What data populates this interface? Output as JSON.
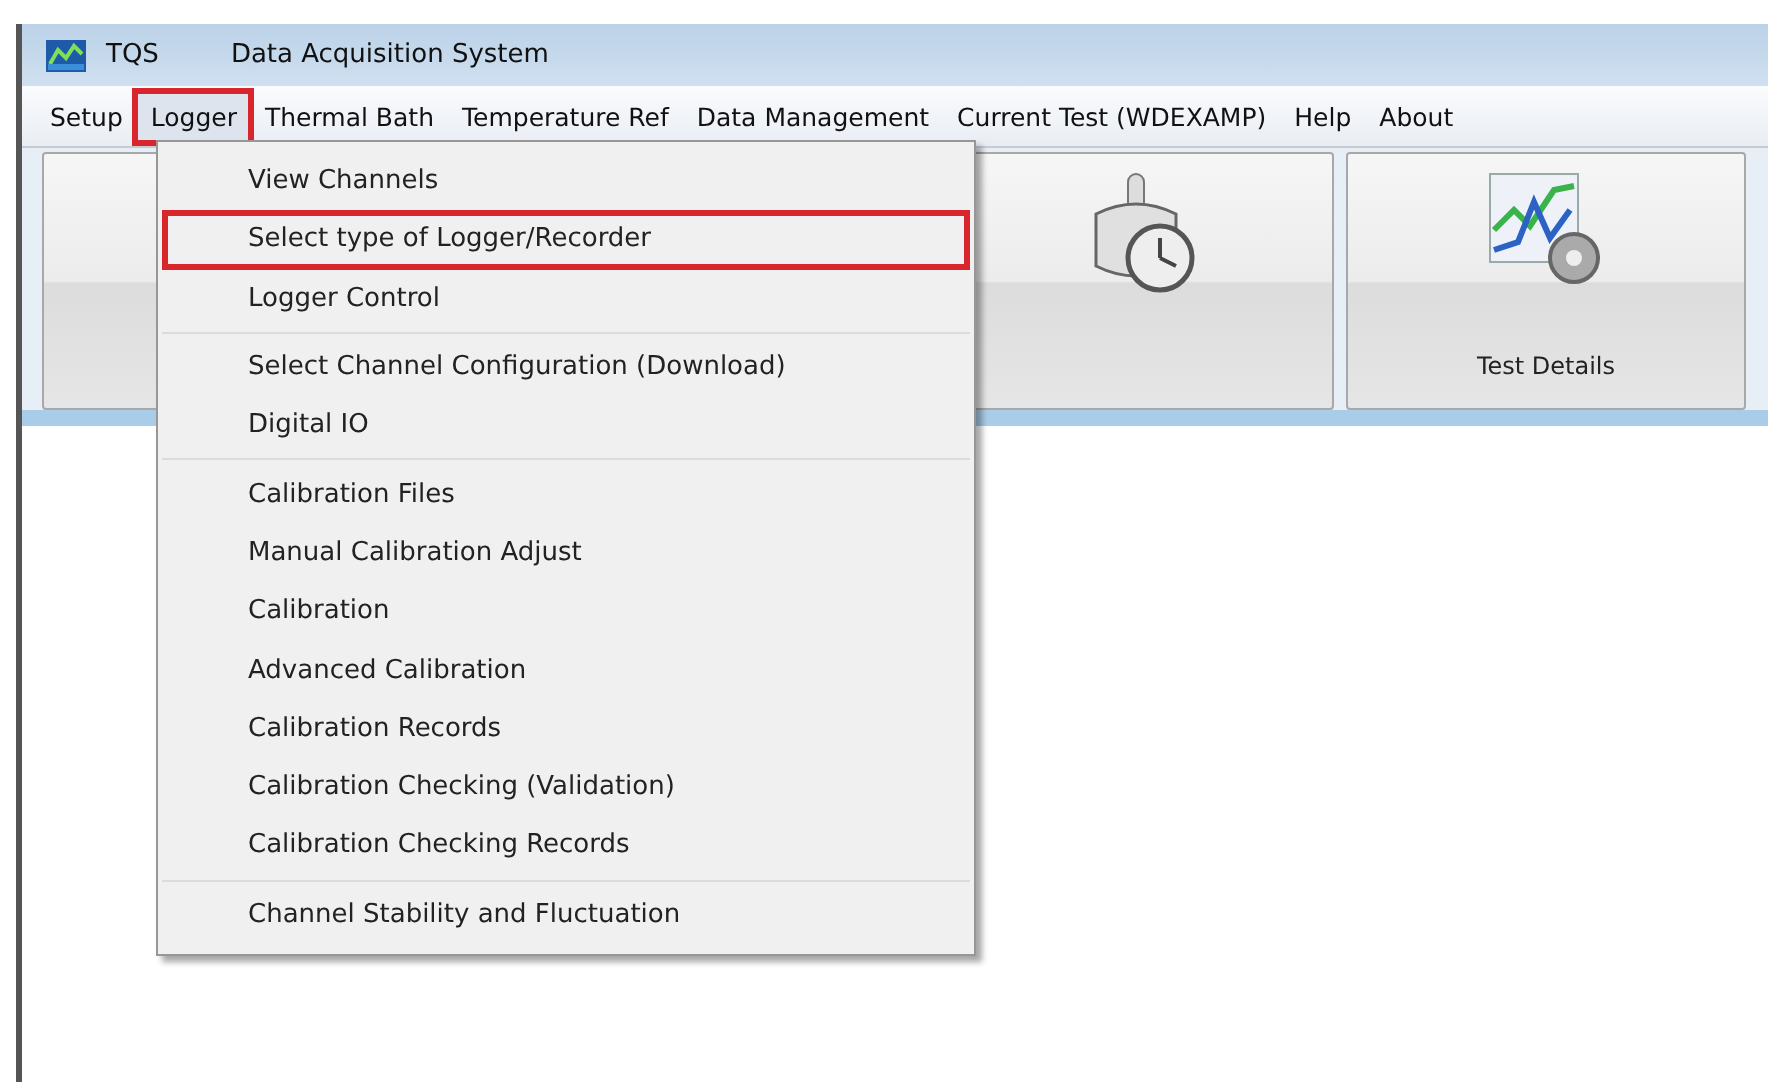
{
  "window": {
    "app_name": "TQS",
    "title": "Data Acquisition System"
  },
  "menu_bar": [
    {
      "label": "Setup",
      "selected": false,
      "highlighted": false
    },
    {
      "label": "Logger",
      "selected": true,
      "highlighted": true
    },
    {
      "label": "Thermal Bath",
      "selected": false,
      "highlighted": false
    },
    {
      "label": "Temperature Ref",
      "selected": false,
      "highlighted": false
    },
    {
      "label": "Data Management",
      "selected": false,
      "highlighted": false
    },
    {
      "label": "Current Test (WDEXAMP)",
      "selected": false,
      "highlighted": false
    },
    {
      "label": "Help",
      "selected": false,
      "highlighted": false
    },
    {
      "label": "About",
      "selected": false,
      "highlighted": false
    }
  ],
  "toolbar": [
    {
      "kind": "blank"
    },
    {
      "kind": "clock"
    },
    {
      "kind": "chart",
      "label": "Test Details"
    }
  ],
  "dropdown": {
    "groups": [
      [
        {
          "label": "View Channels",
          "highlighted": false
        },
        {
          "label": "Select type of Logger/Recorder",
          "highlighted": true
        },
        {
          "label": "Logger Control",
          "highlighted": false
        }
      ],
      [
        {
          "label": "Select Channel Configuration (Download)",
          "highlighted": false
        },
        {
          "label": "Digital IO",
          "highlighted": false
        }
      ],
      [
        {
          "label": "Calibration Files",
          "highlighted": false
        },
        {
          "label": "Manual Calibration Adjust",
          "highlighted": false
        },
        {
          "label": "Calibration",
          "highlighted": false
        },
        {
          "label": "Advanced Calibration",
          "highlighted": false
        },
        {
          "label": "Calibration Records",
          "highlighted": false
        },
        {
          "label": "Calibration Checking (Validation)",
          "highlighted": false
        },
        {
          "label": "Calibration Checking Records",
          "highlighted": false
        }
      ],
      [
        {
          "label": "Channel Stability and Fluctuation",
          "highlighted": false
        }
      ]
    ]
  }
}
